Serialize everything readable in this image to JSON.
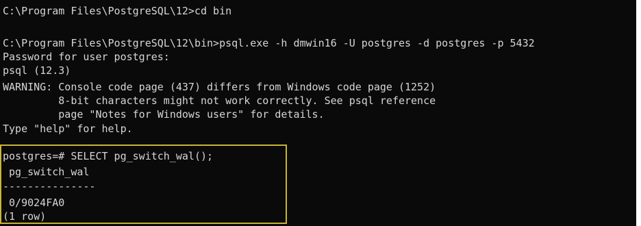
{
  "console": {
    "lines": [
      "C:\\Program Files\\PostgreSQL\\12>cd bin",
      "C:\\Program Files\\PostgreSQL\\12\\bin>psql.exe -h dmwin16 -U postgres -d postgres -p 5432",
      "Password for user postgres:",
      "psql (12.3)",
      "WARNING: Console code page (437) differs from Windows code page (1252)",
      "         8-bit characters might not work correctly. See psql reference",
      "         page \"Notes for Windows users\" for details.",
      "Type \"help\" for help.",
      "postgres=# SELECT pg_switch_wal();",
      " pg_switch_wal",
      "---------------",
      " 0/9024FA0",
      "(1 row)"
    ]
  }
}
